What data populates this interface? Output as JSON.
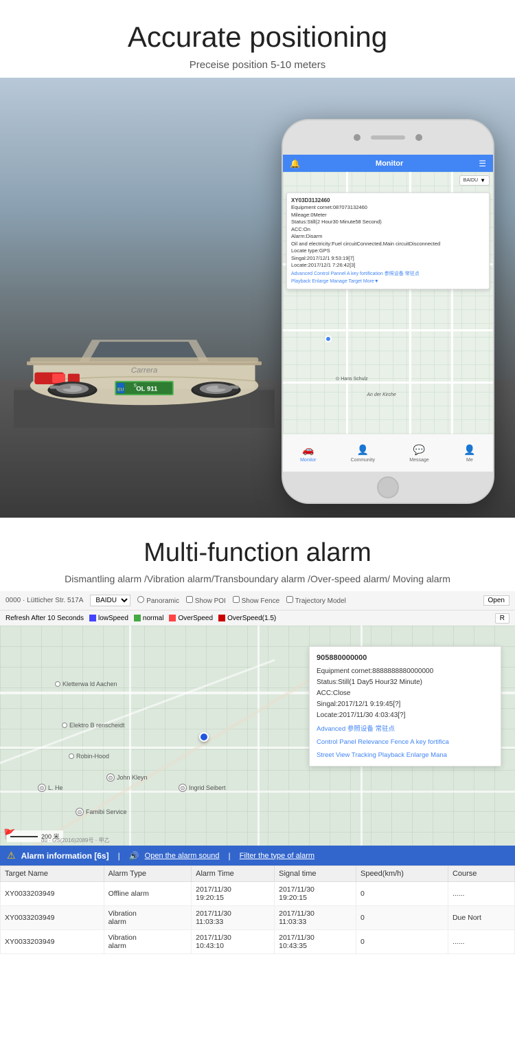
{
  "section1": {
    "title": "Accurate positioning",
    "subtitle": "Preceise position 5-10 meters"
  },
  "phone": {
    "title": "Monitor",
    "device_id": "XY03D3132460",
    "equipment_cornet": "Equipment cornet:087073132460",
    "mileage": "Mileage:0Meter",
    "status": "Status:Still(2 Hour30 Minute58 Second)",
    "acc": "ACC:On",
    "alarm": "Alarm:Disarm",
    "oil_electricity": "Oil and electricity:Fuel circuitConnected.Main circuitDisconnected",
    "locate_type": "Locate type:GPS",
    "singal": "Singal:2017/12/1 9:53:19[7]",
    "locate": "Locate:2017/12/1 7:26:42[3]",
    "links_row1": "Advanced  Control Pannel  A key fortification  参照设备  常驻点",
    "links_row2": "Playback  Enlarge  Manage  Target  More▼",
    "map_label": "BAIDU",
    "nav": {
      "monitor": "Monitor",
      "community": "Community",
      "message": "Message",
      "me": "Me"
    }
  },
  "section2": {
    "title": "Multi-function alarm",
    "subtitle": "Dismantling alarm /Vibration alarm/Transboundary alarm /Over-speed alarm/ Moving alarm"
  },
  "toolbar": {
    "address": "0000 · Lütticher Str. 517A",
    "map_select": "BAIDU",
    "panoramic": "Panoramic",
    "show_poi": "Show POI",
    "show_fence": "Show Fence",
    "trajectory": "Trajectory Model",
    "refresh": "Refresh After 10 Seconds",
    "open_btn": "Open",
    "r_btn": "R"
  },
  "speed_legend": {
    "low_speed": "lowSpeed",
    "normal": "normal",
    "over_speed": "OverSpeed",
    "over_speed_1_5": "OverSpeed(1.5)"
  },
  "map_popup": {
    "device_id": "905880000000",
    "equipment_cornet": "Equipment cornet:8888888880000000",
    "status": "Status:Still(1 Day5 Hour32 Minute)",
    "acc": "ACC:Close",
    "singal": "Singal:2017/12/1 9:19:45[?]",
    "locate": "Locate:2017/11/30 4:03:43[?]",
    "links_row1": "Advanced  参照设备  常驻点",
    "links_row2": "Control Panel  Relevance Fence  A key fortifica",
    "links_row3": "Street View  Tracking  Playback  Enlarge  Mana"
  },
  "map_places": {
    "kletterwald": "Kletterwa ld Aachen",
    "elektro_b": "Elektro B renscheidt",
    "robin_hood": "Robin-Hood",
    "john_kleyn": "John Kleyn",
    "ingrid": "Ingrid Seibert",
    "famibi": "Famibi Service",
    "l_he": "L. He"
  },
  "alarm": {
    "header": "Alarm information [6s]",
    "open_sound": "Open the alarm sound",
    "filter": "Filter the type of alarm",
    "columns": {
      "target_name": "Target Name",
      "alarm_type": "Alarm Type",
      "alarm_time": "Alarm Time",
      "signal_time": "Signal time",
      "speed": "Speed(km/h)",
      "course": "Course"
    },
    "rows": [
      {
        "target": "XY0033203949",
        "type": "Offline alarm",
        "alarm_time": "2017/11/30\n19:20:15",
        "signal_time": "2017/11/30\n19:20:15",
        "speed": "0",
        "course": "......"
      },
      {
        "target": "XY0033203949",
        "type": "Vibration\nalarm",
        "alarm_time": "2017/11/30\n11:03:33",
        "signal_time": "2017/11/30\n11:03:33",
        "speed": "0",
        "course": "Due Nort"
      },
      {
        "target": "XY0033203949",
        "type": "Vibration\nalarm",
        "alarm_time": "2017/11/30\n10:43:10",
        "signal_time": "2017/11/30\n10:43:35",
        "speed": "0",
        "course": "......"
      }
    ]
  },
  "scale": {
    "label": "200 米"
  },
  "watermark": "du · GS(2016)2089号 · 甲乙"
}
